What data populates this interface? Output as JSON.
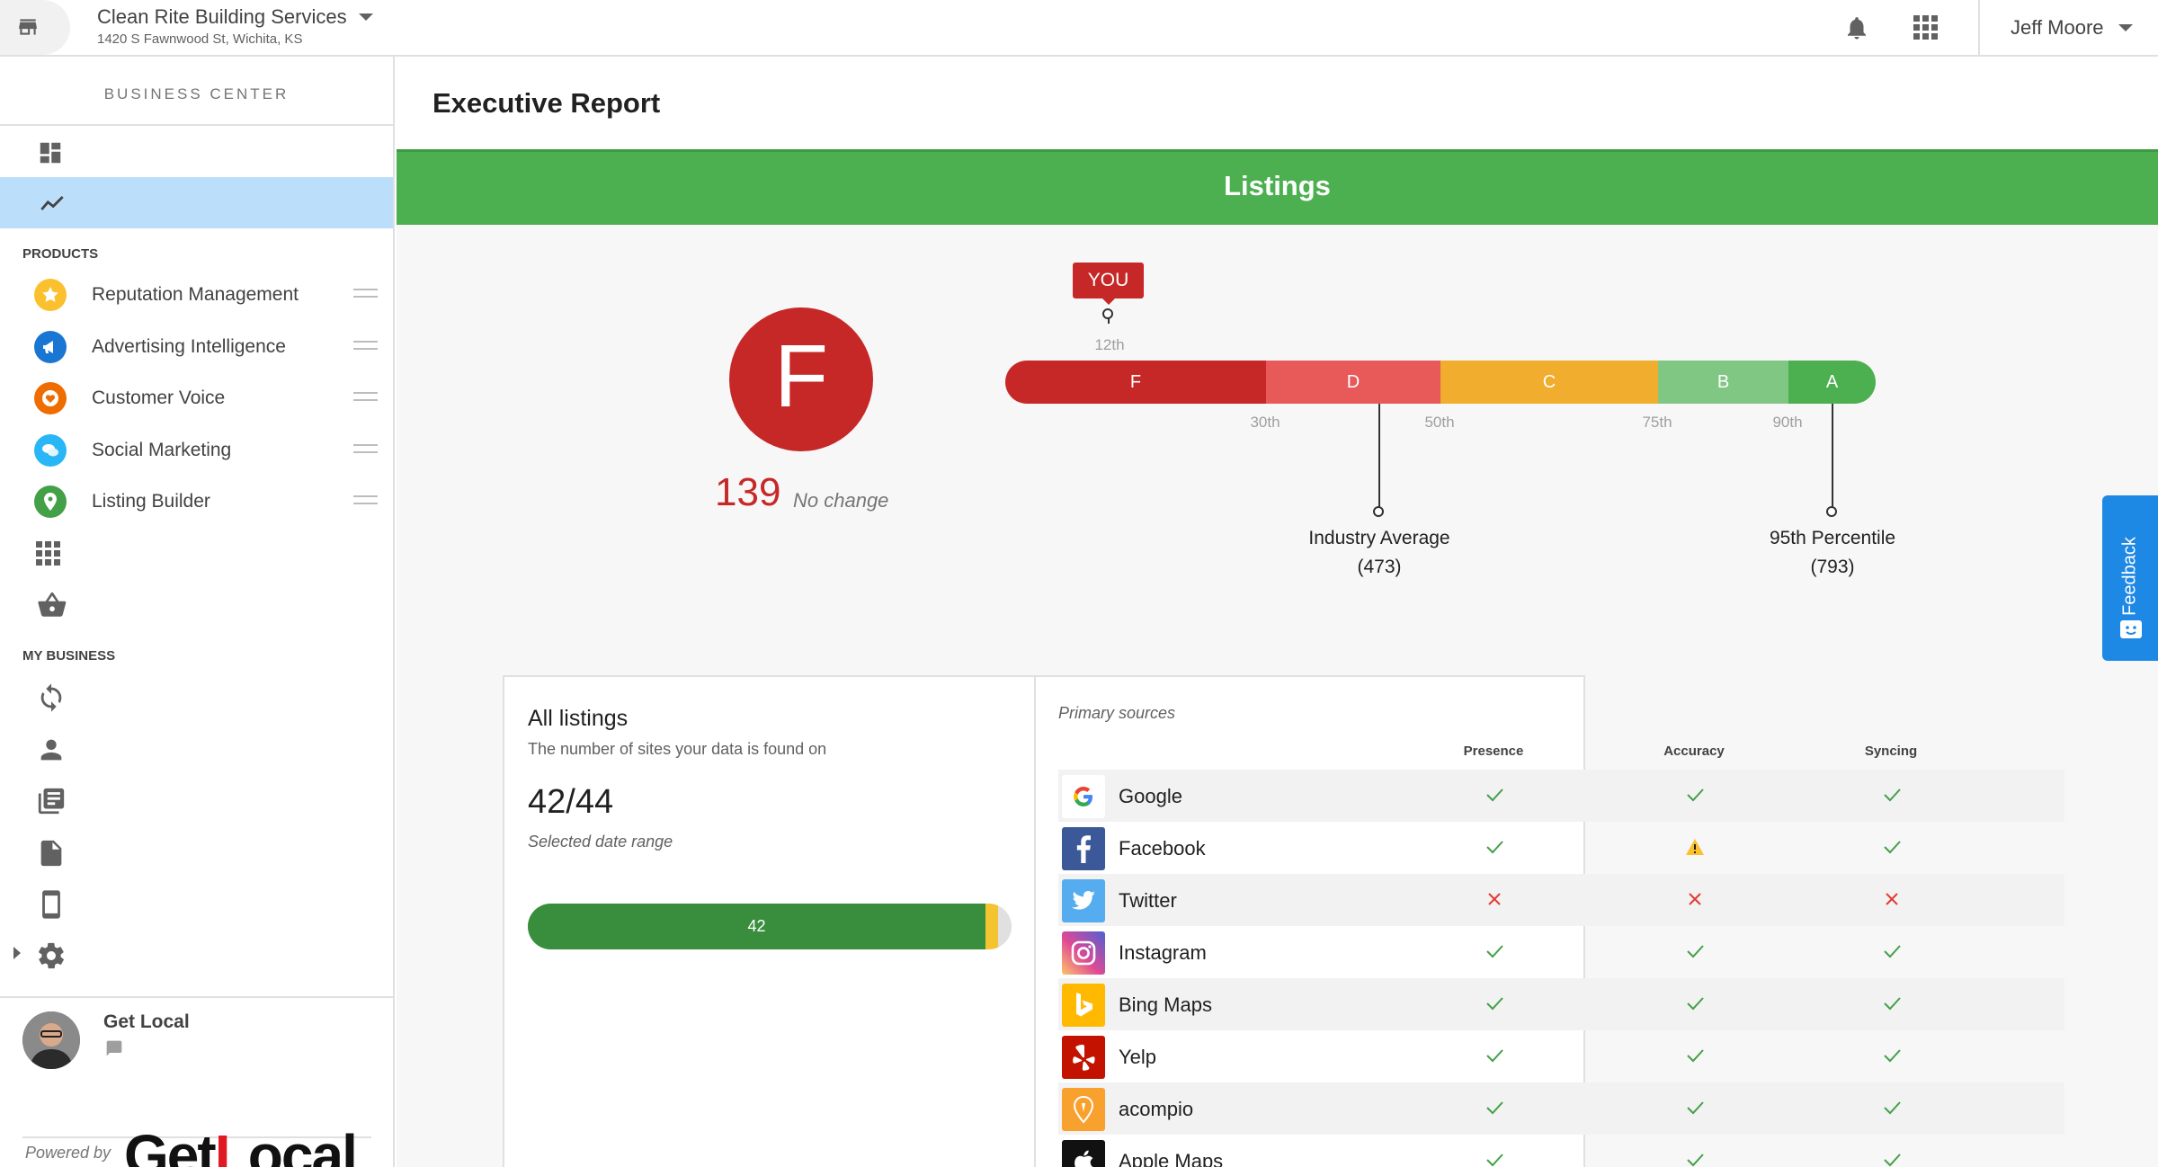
{
  "header": {
    "business_name": "Clean Rite Building Services",
    "business_address": "1420 S Fawnwood St, Wichita, KS",
    "user_name": "Jeff Moore"
  },
  "sidebar": {
    "title": "BUSINESS CENTER",
    "products_heading": "PRODUCTS",
    "products": [
      {
        "label": "Reputation Management",
        "icon": "star-icon",
        "color": "#fbc02d"
      },
      {
        "label": "Advertising Intelligence",
        "icon": "megaphone-icon",
        "color": "#1976d2"
      },
      {
        "label": "Customer Voice",
        "icon": "heart-icon",
        "color": "#ef6c00"
      },
      {
        "label": "Social Marketing",
        "icon": "chat-bubbles-icon",
        "color": "#29b6f6"
      },
      {
        "label": "Listing Builder",
        "icon": "location-pin-icon",
        "color": "#43a047"
      }
    ],
    "my_business_heading": "MY BUSINESS",
    "profile_name": "Get Local",
    "powered_by": "Powered by",
    "logo": {
      "part1": "Get",
      "part2": "L",
      "part3": "ocal"
    }
  },
  "main": {
    "page_title": "Executive Report",
    "section_title": "Listings",
    "grade": "F",
    "score": "139",
    "score_change": "No change",
    "you_label": "YOU",
    "you_percentile": "12th",
    "grade_bar": {
      "segments": [
        {
          "label": "F",
          "color": "#c62828"
        },
        {
          "label": "D",
          "color": "#e85a5a"
        },
        {
          "label": "C",
          "color": "#f0ad2e"
        },
        {
          "label": "B",
          "color": "#81c784"
        },
        {
          "label": "A",
          "color": "#4caf50"
        }
      ],
      "ticks": [
        "30th",
        "50th",
        "75th",
        "90th"
      ],
      "industry_average_label": "Industry Average",
      "industry_average_value": "(473)",
      "top_percentile_label": "95th Percentile",
      "top_percentile_value": "(793)"
    }
  },
  "feedback_label": "Feedback",
  "all_listings": {
    "title": "All listings",
    "subtitle": "The number of sites your data is found on",
    "count": "42/44",
    "range_label": "Selected date range",
    "bar_value": "42"
  },
  "primary_sources": {
    "title": "Primary sources",
    "columns": [
      "Presence",
      "Accuracy",
      "Syncing"
    ],
    "rows": [
      {
        "name": "Google",
        "logo": "google-logo",
        "presence": "check",
        "accuracy": "check",
        "syncing": "check"
      },
      {
        "name": "Facebook",
        "logo": "facebook-logo",
        "presence": "check",
        "accuracy": "warning",
        "syncing": "check"
      },
      {
        "name": "Twitter",
        "logo": "twitter-logo",
        "presence": "cross",
        "accuracy": "cross",
        "syncing": "cross"
      },
      {
        "name": "Instagram",
        "logo": "instagram-logo",
        "presence": "check",
        "accuracy": "check",
        "syncing": "check"
      },
      {
        "name": "Bing Maps",
        "logo": "bing-logo",
        "presence": "check",
        "accuracy": "check",
        "syncing": "check"
      },
      {
        "name": "Yelp",
        "logo": "yelp-logo",
        "presence": "check",
        "accuracy": "check",
        "syncing": "check"
      },
      {
        "name": "acompio",
        "logo": "acompio-logo",
        "presence": "check",
        "accuracy": "check",
        "syncing": "check"
      },
      {
        "name": "Apple Maps",
        "logo": "apple-logo",
        "presence": "check",
        "accuracy": "check",
        "syncing": "check"
      }
    ]
  }
}
